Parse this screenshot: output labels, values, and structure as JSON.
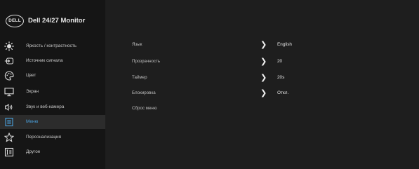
{
  "brand": {
    "logo_text": "DELL",
    "title": "Dell 24/27 Monitor"
  },
  "sidebar": {
    "items": [
      {
        "label": "Яркость / контрастность",
        "icon": "brightness-icon"
      },
      {
        "label": "Источник сигнала",
        "icon": "input-source-icon"
      },
      {
        "label": "Цвет",
        "icon": "color-palette-icon"
      },
      {
        "label": "Экран",
        "icon": "display-icon"
      },
      {
        "label": "Звук и веб-камера",
        "icon": "audio-webcam-icon"
      },
      {
        "label": "Меню",
        "icon": "menu-icon"
      },
      {
        "label": "Персонализация",
        "icon": "star-icon"
      },
      {
        "label": "Другое",
        "icon": "other-icon"
      }
    ],
    "active_index": 5
  },
  "settings": {
    "rows": [
      {
        "label": "Язык",
        "value": "English",
        "has_chevron": true
      },
      {
        "label": "Прозрачность",
        "value": "20",
        "has_chevron": true
      },
      {
        "label": "Таймер",
        "value": "20s",
        "has_chevron": true
      },
      {
        "label": "Блокировка",
        "value": "Откл.",
        "has_chevron": true
      },
      {
        "label": "Сброс меню",
        "value": "",
        "has_chevron": false
      }
    ]
  },
  "colors": {
    "background": "#1e1e1e",
    "sidebar": "#151515",
    "accent": "#4aa0dc"
  }
}
